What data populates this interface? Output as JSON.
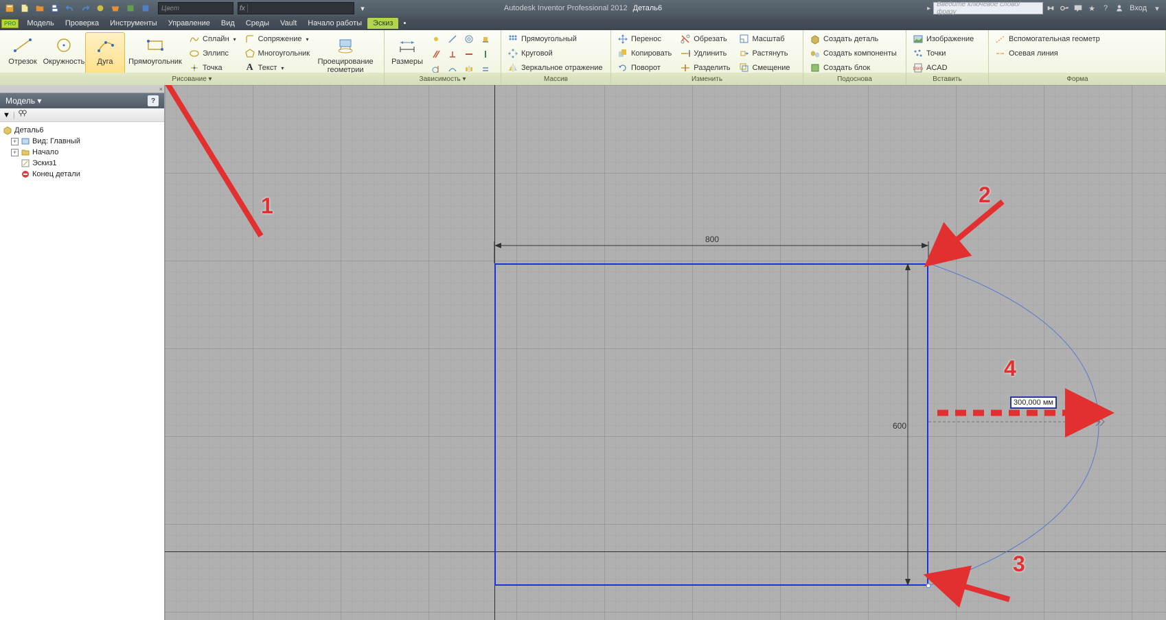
{
  "title": {
    "app": "Autodesk Inventor Professional 2012",
    "doc": "Деталь6"
  },
  "qat_color_placeholder": "Цвет",
  "search_placeholder": "Введите ключевое слово/фразу",
  "login_label": "Вход",
  "menu": {
    "items": [
      "Модель",
      "Проверка",
      "Инструменты",
      "Управление",
      "Вид",
      "Среды",
      "Vault",
      "Начало работы",
      "Эскиз"
    ],
    "active": "Эскиз"
  },
  "ribbon": {
    "draw": {
      "line": "Отрезок",
      "circle": "Окружность",
      "arc": "Дуга",
      "rect": "Прямоугольник",
      "spline": "Сплайн",
      "ellipse": "Эллипс",
      "point": "Точка",
      "fillet": "Сопряжение",
      "polygon": "Многоугольник",
      "text": "Текст",
      "project": "Проецирование\nгеометрии",
      "panel": "Рисование"
    },
    "constrain": {
      "dimension": "Размеры",
      "panel": "Зависимость"
    },
    "pattern": {
      "rect": "Прямоугольный",
      "circ": "Круговой",
      "mirror": "Зеркальное отражение",
      "panel": "Массив"
    },
    "modify": {
      "move": "Перенос",
      "copy": "Копировать",
      "rotate": "Поворот",
      "trim": "Обрезать",
      "extend": "Удлинить",
      "split": "Разделить",
      "scale": "Масштаб",
      "stretch": "Растянуть",
      "offset": "Смещение",
      "panel": "Изменить"
    },
    "layout": {
      "makepart": "Создать деталь",
      "makecomp": "Создать компоненты",
      "makeblock": "Создать блок",
      "panel": "Подоснова"
    },
    "insert": {
      "image": "Изображение",
      "points": "Точки",
      "acad": "ACAD",
      "panel": "Вставить"
    },
    "format": {
      "construction": "Вспомогательная геометр",
      "centerline": "Осевая линия",
      "panel": "Форма"
    }
  },
  "browser": {
    "title": "Модель",
    "root": "Деталь6",
    "view": "Вид: Главный",
    "origin": "Начало",
    "sketch": "Эскиз1",
    "eop": "Конец детали"
  },
  "dims": {
    "width": "800",
    "height": "600"
  },
  "input_value": "300,000 мм",
  "annotations": {
    "n1": "1",
    "n2": "2",
    "n3": "3",
    "n4": "4"
  }
}
